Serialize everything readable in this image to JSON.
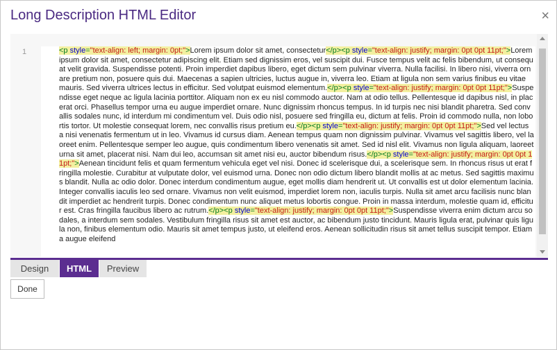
{
  "dialog": {
    "title": "Long Description HTML Editor",
    "close_symbol": "×"
  },
  "editor": {
    "line_number": "1",
    "segments": [
      {
        "t": "tag",
        "s": "<p "
      },
      {
        "t": "attr",
        "s": "style"
      },
      {
        "t": "tag",
        "s": "="
      },
      {
        "t": "val",
        "s": "\"text-align: left; margin: 0pt;\""
      },
      {
        "t": "tag",
        "s": ">"
      },
      {
        "t": "text",
        "s": "Lorem ipsum dolor sit amet, consectetur"
      },
      {
        "t": "tag",
        "s": "</p><p "
      },
      {
        "t": "attr",
        "s": "style"
      },
      {
        "t": "tag",
        "s": "="
      },
      {
        "t": "val",
        "s": "\"text-align: justify; margin: 0pt 0pt 11pt;\""
      },
      {
        "t": "tag",
        "s": ">"
      },
      {
        "t": "text",
        "s": "Lorem ipsum dolor sit amet, consectetur adipiscing elit. Etiam sed dignissim eros, vel suscipit dui. Fusce tempus velit ac felis bibendum, ut consequat velit gravida. Suspendisse potenti. Proin imperdiet dapibus libero, eget dictum sem pulvinar viverra. Nulla facilisi. In libero nisi, viverra ornare pretium non, posuere quis dui. Maecenas a sapien ultricies, luctus augue in, viverra leo. Etiam at ligula non sem varius finibus eu vitae mauris. Sed viverra ultrices lectus in efficitur. Sed volutpat euismod elementum."
      },
      {
        "t": "tag",
        "s": "</p><p "
      },
      {
        "t": "attr",
        "s": "style"
      },
      {
        "t": "tag",
        "s": "="
      },
      {
        "t": "val",
        "s": "\"text-align: justify; margin: 0pt 0pt 11pt;\""
      },
      {
        "t": "tag",
        "s": ">"
      },
      {
        "t": "text",
        "s": "Suspendisse eget neque ac ligula lacinia porttitor. Aliquam non ex eu nisl commodo auctor. Nam at odio tellus. Pellentesque id dapibus nisl, in placerat orci. Phasellus tempor urna eu augue imperdiet ornare. Nunc dignissim rhoncus tempus. In id turpis nec nisi blandit pharetra. Sed convallis sodales nunc, id interdum mi condimentum vel. Duis odio nisl, posuere sed fringilla eu, dictum at felis. Proin id commodo nulla, non lobortis tortor. Ut molestie consequat lorem, nec convallis risus pretium eu."
      },
      {
        "t": "tag",
        "s": "</p><p "
      },
      {
        "t": "attr",
        "s": "style"
      },
      {
        "t": "tag",
        "s": "="
      },
      {
        "t": "val",
        "s": "\"text-align: justify; margin: 0pt 0pt 11pt;\""
      },
      {
        "t": "tag",
        "s": ">"
      },
      {
        "t": "text",
        "s": "Sed vel lectus a nisi venenatis fermentum ut in leo. Vivamus id cursus diam. Aenean tempus quam non dignissim pulvinar. Vivamus vel sagittis libero, vel laoreet enim. Pellentesque semper leo augue, quis condimentum libero venenatis sit amet. Sed id nisl elit. Vivamus non ligula aliquam, laoreet urna sit amet, placerat nisi. Nam dui leo, accumsan sit amet nisi eu, auctor bibendum risus."
      },
      {
        "t": "tag",
        "s": "</p><p "
      },
      {
        "t": "attr",
        "s": "style"
      },
      {
        "t": "tag",
        "s": "="
      },
      {
        "t": "val",
        "s": "\"text-align: justify; margin: 0pt 0pt 11pt;\""
      },
      {
        "t": "tag",
        "s": ">"
      },
      {
        "t": "text",
        "s": "Aenean tincidunt felis et quam fermentum vehicula eget vel nisi. Donec id scelerisque dui, a scelerisque sem. In rhoncus risus ut erat fringilla molestie. Curabitur at vulputate dolor, vel euismod urna. Donec non odio dictum libero blandit mollis at ac metus. Sed sagittis maximus blandit. Nulla ac odio dolor. Donec interdum condimentum augue, eget mollis diam hendrerit ut. Ut convallis est ut dolor elementum lacinia. Integer convallis iaculis leo sed ornare. Vivamus non velit euismod, imperdiet lorem non, iaculis turpis. Nulla sit amet arcu facilisis nunc blandit imperdiet ac hendrerit turpis. Donec condimentum nunc aliquet metus lobortis congue. Proin in massa interdum, molestie quam id, efficitur est. Cras fringilla faucibus libero ac rutrum."
      },
      {
        "t": "tag",
        "s": "</p><p "
      },
      {
        "t": "attr",
        "s": "style"
      },
      {
        "t": "tag",
        "s": "="
      },
      {
        "t": "val",
        "s": "\"text-align: justify; margin: 0pt 0pt 11pt;\""
      },
      {
        "t": "tag",
        "s": ">"
      },
      {
        "t": "text",
        "s": "Suspendisse viverra enim dictum arcu sodales, a interdum sem sodales. Vestibulum fringilla risus sit amet est auctor, ac bibendum justo tincidunt. Mauris ligula erat, pulvinar quis ligula non, finibus elementum odio. Mauris sit amet tempus justo, ut eleifend eros. Aenean sollicitudin risus sit amet tellus suscipit tempor. Etiam a augue eleifend"
      }
    ]
  },
  "tabs": [
    {
      "label": "Design",
      "active": false
    },
    {
      "label": "HTML",
      "active": true
    },
    {
      "label": "Preview",
      "active": false
    }
  ],
  "footer": {
    "done_label": "Done"
  },
  "colors": {
    "accent": "#5b2d90",
    "title": "#4a2a82",
    "highlight": "#f3f0a0"
  }
}
